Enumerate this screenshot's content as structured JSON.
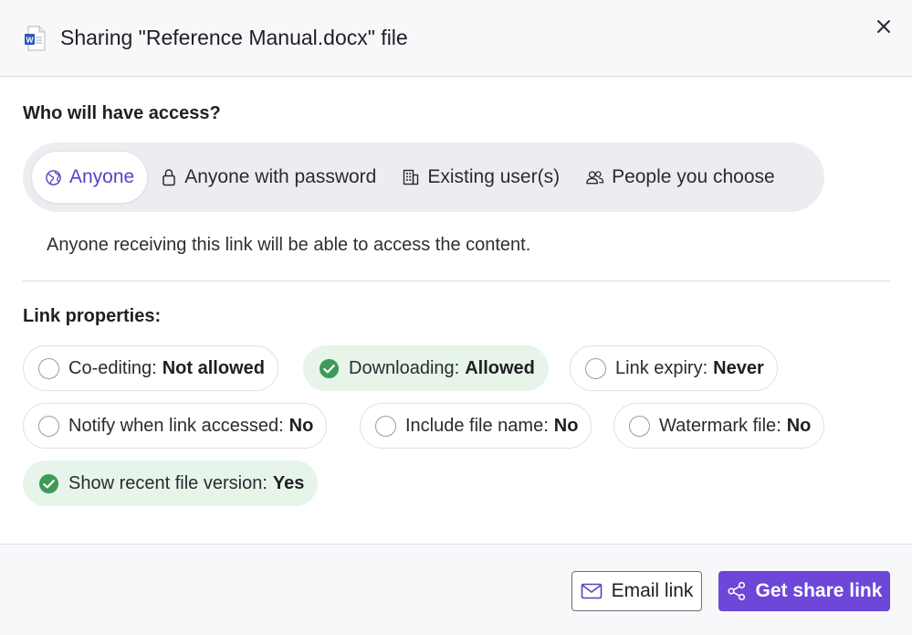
{
  "dialog": {
    "title": "Sharing \"Reference Manual.docx\" file",
    "file_icon": "word-doc-icon",
    "close_icon": "close-icon"
  },
  "access": {
    "label": "Who will have access?",
    "options": [
      {
        "label": "Anyone",
        "icon": "globe-icon",
        "selected": true
      },
      {
        "label": "Anyone with password",
        "icon": "lock-icon",
        "selected": false
      },
      {
        "label": "Existing user(s)",
        "icon": "building-icon",
        "selected": false
      },
      {
        "label": "People you choose",
        "icon": "people-icon",
        "selected": false
      }
    ],
    "description": "Anyone receiving this link will be able to access the content."
  },
  "properties": {
    "label": "Link properties:",
    "items": [
      {
        "name": "Co-editing:",
        "value": "Not allowed",
        "enabled": false
      },
      {
        "name": "Downloading:",
        "value": "Allowed",
        "enabled": true
      },
      {
        "name": "Link expiry:",
        "value": "Never",
        "enabled": false
      },
      {
        "name": "Notify when link accessed:",
        "value": "No",
        "enabled": false
      },
      {
        "name": "Include file name:",
        "value": "No",
        "enabled": false
      },
      {
        "name": "Watermark file:",
        "value": "No",
        "enabled": false
      },
      {
        "name": "Show recent file version:",
        "value": "Yes",
        "enabled": true
      }
    ]
  },
  "footer": {
    "email_label": "Email link",
    "share_label": "Get share link"
  },
  "colors": {
    "accent": "#6c47d8",
    "active_text": "#5b3fc4",
    "enabled_bg": "#e6f4ea",
    "check_green": "#3f9a57"
  }
}
